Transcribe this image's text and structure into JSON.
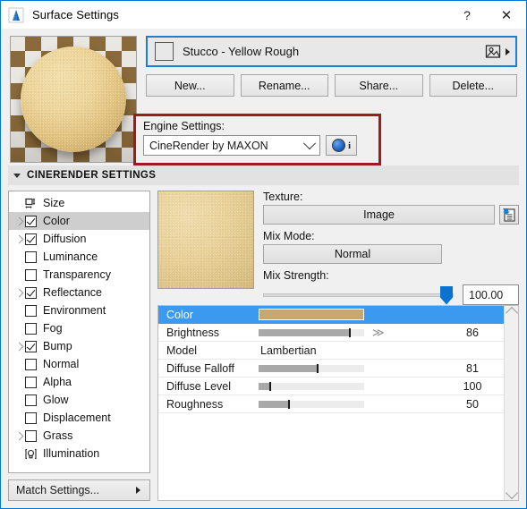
{
  "window": {
    "title": "Surface Settings",
    "app_icon": "mountain-icon",
    "help_label": "?",
    "close_label": "✕"
  },
  "material": {
    "name": "Stucco - Yellow Rough",
    "swatch_color": "#dcc07e",
    "preview_icon": "image-icon",
    "expand_icon": "triangle-right-icon"
  },
  "action_buttons": [
    {
      "label": "New...",
      "name": "new-button"
    },
    {
      "label": "Rename...",
      "name": "rename-button"
    },
    {
      "label": "Share...",
      "name": "share-button"
    },
    {
      "label": "Delete...",
      "name": "delete-button"
    }
  ],
  "engine": {
    "label": "Engine Settings:",
    "selected": "CineRender by MAXON",
    "info_icon": "sphere-icon",
    "info_letter": "i",
    "highlight_color": "#9e1b1b"
  },
  "section": {
    "title": "CINERENDER SETTINGS",
    "collapse_icon": "triangle-down-icon"
  },
  "channels": [
    {
      "label": "Size",
      "icon": "size-icon",
      "checkbox": false,
      "checked": false,
      "expandable": false,
      "selected": false
    },
    {
      "label": "Color",
      "icon": null,
      "checkbox": true,
      "checked": true,
      "expandable": true,
      "selected": true
    },
    {
      "label": "Diffusion",
      "icon": null,
      "checkbox": true,
      "checked": true,
      "expandable": true,
      "selected": false
    },
    {
      "label": "Luminance",
      "icon": null,
      "checkbox": true,
      "checked": false,
      "expandable": false,
      "selected": false
    },
    {
      "label": "Transparency",
      "icon": null,
      "checkbox": true,
      "checked": false,
      "expandable": false,
      "selected": false
    },
    {
      "label": "Reflectance",
      "icon": null,
      "checkbox": true,
      "checked": true,
      "expandable": true,
      "selected": false
    },
    {
      "label": "Environment",
      "icon": null,
      "checkbox": true,
      "checked": false,
      "expandable": false,
      "selected": false
    },
    {
      "label": "Fog",
      "icon": null,
      "checkbox": true,
      "checked": false,
      "expandable": false,
      "selected": false
    },
    {
      "label": "Bump",
      "icon": null,
      "checkbox": true,
      "checked": true,
      "expandable": true,
      "selected": false
    },
    {
      "label": "Normal",
      "icon": null,
      "checkbox": true,
      "checked": false,
      "expandable": false,
      "selected": false
    },
    {
      "label": "Alpha",
      "icon": null,
      "checkbox": true,
      "checked": false,
      "expandable": false,
      "selected": false
    },
    {
      "label": "Glow",
      "icon": null,
      "checkbox": true,
      "checked": false,
      "expandable": false,
      "selected": false
    },
    {
      "label": "Displacement",
      "icon": null,
      "checkbox": true,
      "checked": false,
      "expandable": false,
      "selected": false
    },
    {
      "label": "Grass",
      "icon": null,
      "checkbox": true,
      "checked": false,
      "expandable": true,
      "selected": false
    },
    {
      "label": "Illumination",
      "icon": "illumination-icon",
      "checkbox": false,
      "checked": false,
      "expandable": false,
      "selected": false
    }
  ],
  "match_settings": {
    "label": "Match Settings...",
    "arrow_icon": "triangle-right-icon"
  },
  "texture_panel": {
    "texture_label": "Texture:",
    "texture_value": "Image",
    "texture_side_icon": "document-import-icon",
    "mix_mode_label": "Mix Mode:",
    "mix_mode_value": "Normal",
    "mix_strength_label": "Mix Strength:",
    "mix_strength_value": "100.00",
    "mix_strength_percent": 100
  },
  "properties": [
    {
      "name": "Color",
      "type": "color",
      "color": "#c4a870",
      "selected": true
    },
    {
      "name": "Brightness",
      "type": "slider",
      "value": "86",
      "percent": 86,
      "has_chevron": true,
      "selected": false
    },
    {
      "name": "Model",
      "type": "text",
      "value": "Lambertian",
      "selected": false
    },
    {
      "name": "Diffuse Falloff",
      "type": "slider",
      "value": "81",
      "percent": 55,
      "has_chevron": false,
      "selected": false
    },
    {
      "name": "Diffuse Level",
      "type": "slider",
      "value": "100",
      "percent": 10,
      "has_chevron": false,
      "selected": false
    },
    {
      "name": "Roughness",
      "type": "slider",
      "value": "50",
      "percent": 28,
      "has_chevron": false,
      "selected": false
    }
  ],
  "scrollbar": {
    "up_icon": "chevron-up-icon",
    "down_icon": "chevron-down-icon"
  }
}
